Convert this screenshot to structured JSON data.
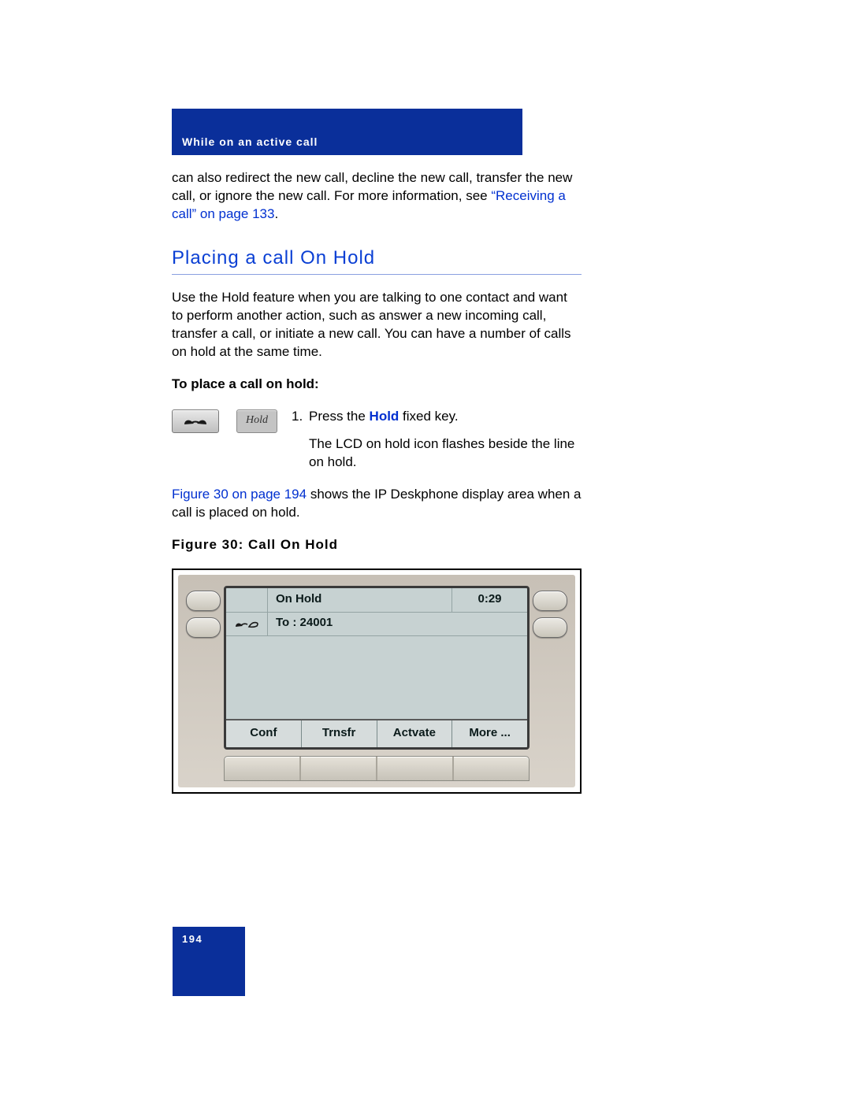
{
  "header": {
    "running_head": "While on an active call"
  },
  "intro": {
    "text_before_link": "can also redirect the new call, decline the new call, transfer the new call, or ignore the new call. For more information, see ",
    "link_text": "“Receiving a call” on page 133",
    "text_after_link": "."
  },
  "section": {
    "heading": "Placing a call On Hold",
    "body": "Use the Hold feature when you are talking to one contact and want to perform another action, such as answer a new incoming call, transfer a call, or initiate a new call. You can have a number of calls on hold at the same time.",
    "subhead": "To place a call on hold:"
  },
  "step": {
    "hold_key_label": "Hold",
    "number": "1.",
    "text_before": "Press the ",
    "key_name": "Hold",
    "text_after": " fixed key.",
    "followup": "The LCD on hold icon flashes beside the line on hold."
  },
  "figure_ref": {
    "link": "Figure 30 on page 194",
    "rest": " shows the IP Deskphone display area when a call is placed on hold."
  },
  "figure": {
    "caption": "Figure 30: Call On Hold",
    "lcd": {
      "row1_status": "On Hold",
      "row1_time": "0:29",
      "row2_label": "To : 24001"
    },
    "softkeys": [
      "Conf",
      "Trnsfr",
      "Actvate",
      "More ..."
    ]
  },
  "footer": {
    "page_number": "194"
  }
}
